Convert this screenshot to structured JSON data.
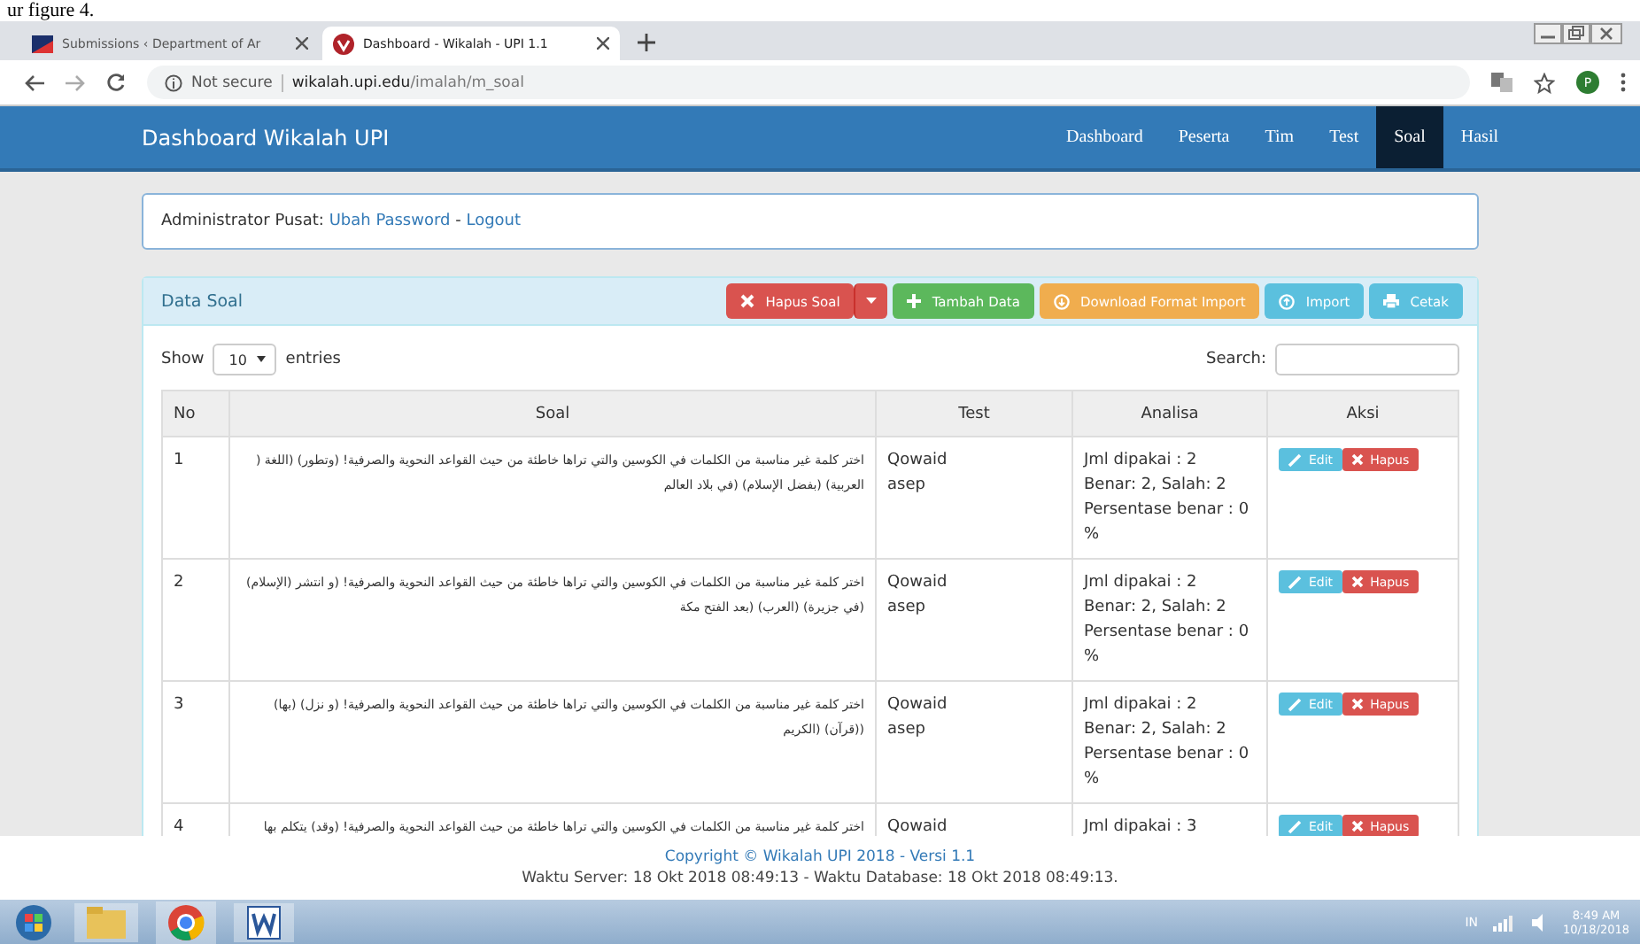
{
  "document_caption": "ur figure 4.",
  "browser": {
    "tabs": [
      {
        "title": "Submissions ‹ Department of Ar",
        "kind": "flag",
        "selected": false
      },
      {
        "title": "Dashboard - Wikalah - UPI 1.1",
        "kind": "logo",
        "selected": true
      }
    ],
    "url": {
      "security": "Not secure",
      "host": "wikalah.upi.edu",
      "path": "/imalah/m_soal"
    },
    "profile": "P"
  },
  "navbar": {
    "brand": "Dashboard Wikalah UPI",
    "items": [
      {
        "label": "Dashboard",
        "selected": false
      },
      {
        "label": "Peserta",
        "selected": false
      },
      {
        "label": "Tim",
        "selected": false
      },
      {
        "label": "Test",
        "selected": false
      },
      {
        "label": "Soal",
        "selected": true
      },
      {
        "label": "Hasil",
        "selected": false
      }
    ]
  },
  "user_bar": {
    "role": "Administrator Pusat:",
    "links": [
      "Ubah Password",
      "Logout"
    ],
    "separator": "-"
  },
  "panel": {
    "title": "Data Soal",
    "buttons": [
      {
        "label": "Hapus Soal",
        "kind": "delete"
      },
      {
        "label": "Tambah Data",
        "kind": "add"
      },
      {
        "label": "Download Format Import",
        "kind": "download"
      },
      {
        "label": "Import",
        "kind": "import"
      },
      {
        "label": "Cetak",
        "kind": "print"
      }
    ],
    "length_menu": {
      "prefix": "Show",
      "value": "10",
      "suffix": "entries"
    },
    "search": {
      "label": "Search:"
    },
    "table": {
      "columns": [
        "No",
        "Soal",
        "Test",
        "Analisa",
        "Aksi"
      ],
      "rows": [
        {
          "no": "1",
          "soal": "اختر كلمة غير مناسبة من الكلمات في الكوسين والتي تراها خاطئة من حيث القواعد النحوية والصرفية! (وتطور) (اللغة ( العربية) (بفضل الإسلام) (في بلاد العالم",
          "test": [
            "Qowaid",
            "asep"
          ],
          "analisa": [
            "Jml dipakai : 2",
            "Benar: 2, Salah: 2",
            "Persentase benar : 0 %"
          ],
          "actions": [
            "Edit",
            "Hapus"
          ]
        },
        {
          "no": "2",
          "soal": "اختر كلمة غير مناسبة من الكلمات في الكوسين والتي تراها خاطئة من حيث القواعد النحوية والصرفية! (و انتشر (الإسلام) (في جزيرة) (العرب) (بعد الفتح مكة",
          "test": [
            "Qowaid",
            "asep"
          ],
          "analisa": [
            "Jml dipakai : 2",
            "Benar: 2, Salah: 2",
            "Persentase benar : 0 %"
          ],
          "actions": [
            "Edit",
            "Hapus"
          ]
        },
        {
          "no": "3",
          "soal": "اختر كلمة غير مناسبة من الكلمات في الكوسين والتي تراها خاطئة من حيث القواعد النحوية والصرفية! (و نزل) (بها) ((قرآن) (الكريم",
          "test": [
            "Qowaid",
            "asep"
          ],
          "analisa": [
            "Jml dipakai : 2",
            "Benar: 2, Salah: 2",
            "Persentase benar : 0 %"
          ],
          "actions": [
            "Edit",
            "Hapus"
          ]
        },
        {
          "no": "4",
          "soal": "اختر كلمة غير مناسبة من الكلمات في الكوسين والتي تراها خاطئة من حيث القواعد النحوية والصرفية! (وقد) يتكلم بها",
          "test": [
            "Qowaid"
          ],
          "analisa": [
            "Jml dipakai : 3"
          ],
          "actions": [
            "Edit",
            "Hapus"
          ]
        }
      ]
    }
  },
  "footer": {
    "copyright": "Copyright © Wikalah UPI 2018 - Versi 1.1",
    "times": "Waktu Server: 18 Okt 2018 08:49:13 - Waktu Database: 18 Okt 2018 08:49:13."
  },
  "taskbar": {
    "language": "IN",
    "time": "8:49 AM",
    "date": "10/18/2018"
  }
}
